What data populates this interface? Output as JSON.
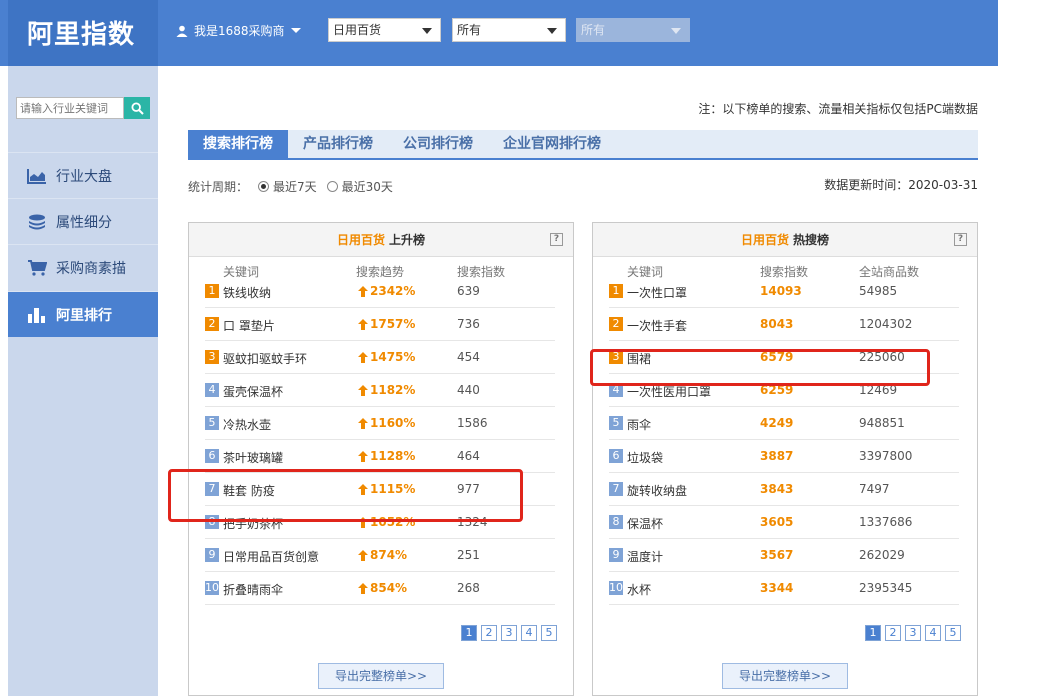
{
  "header": {
    "logo": "阿里指数",
    "user_label": "我是1688采购商",
    "select1": "日用百货",
    "select2": "所有",
    "select3": "所有"
  },
  "sidebar": {
    "search_placeholder": "请输入行业关键词",
    "items": [
      {
        "label": "行业大盘",
        "icon": "chart-icon"
      },
      {
        "label": "属性细分",
        "icon": "layers-icon"
      },
      {
        "label": "采购商素描",
        "icon": "cart-icon"
      },
      {
        "label": "阿里排行",
        "icon": "bar-rank-icon",
        "active": true
      }
    ]
  },
  "main": {
    "note": "注：以下榜单的搜索、流量相关指标仅包括PC端数据",
    "tabs": [
      "搜索排行榜",
      "产品排行榜",
      "公司排行榜",
      "企业官网排行榜"
    ],
    "period_label": "统计周期：",
    "period_options": [
      "最近7天",
      "最近30天"
    ],
    "updated": "数据更新时间：2020-03-31"
  },
  "left_panel": {
    "category": "日用百货",
    "kind": "上升榜",
    "cols": [
      "关键词",
      "搜索趋势",
      "搜索指数"
    ],
    "rows": [
      {
        "rank": "1",
        "kw": "铁线收纳",
        "trend": "2342%",
        "idx": "639"
      },
      {
        "rank": "2",
        "kw": "口 罩垫片",
        "trend": "1757%",
        "idx": "736"
      },
      {
        "rank": "3",
        "kw": "驱蚊扣驱蚊手环",
        "trend": "1475%",
        "idx": "454"
      },
      {
        "rank": "4",
        "kw": "蛋壳保温杯",
        "trend": "1182%",
        "idx": "440"
      },
      {
        "rank": "5",
        "kw": "冷热水壶",
        "trend": "1160%",
        "idx": "1586"
      },
      {
        "rank": "6",
        "kw": "茶叶玻璃罐",
        "trend": "1128%",
        "idx": "464"
      },
      {
        "rank": "7",
        "kw": "鞋套 防疫",
        "trend": "1115%",
        "idx": "977"
      },
      {
        "rank": "8",
        "kw": "把手奶茶杯",
        "trend": "1052%",
        "idx": "1324"
      },
      {
        "rank": "9",
        "kw": "日常用品百货创意",
        "trend": "874%",
        "idx": "251"
      },
      {
        "rank": "10",
        "kw": "折叠晴雨伞",
        "trend": "854%",
        "idx": "268"
      }
    ],
    "pages": [
      "1",
      "2",
      "3",
      "4",
      "5"
    ],
    "export": "导出完整榜单>>"
  },
  "right_panel": {
    "category": "日用百货",
    "kind": "热搜榜",
    "cols": [
      "关键词",
      "搜索指数",
      "全站商品数"
    ],
    "rows": [
      {
        "rank": "1",
        "kw": "一次性口罩",
        "idx": "14093",
        "count": "54985"
      },
      {
        "rank": "2",
        "kw": "一次性手套",
        "idx": "8043",
        "count": "1204302"
      },
      {
        "rank": "3",
        "kw": "围裙",
        "idx": "6579",
        "count": "225060"
      },
      {
        "rank": "4",
        "kw": "一次性医用口罩",
        "idx": "6259",
        "count": "12469"
      },
      {
        "rank": "5",
        "kw": "雨伞",
        "idx": "4249",
        "count": "948851"
      },
      {
        "rank": "6",
        "kw": "垃圾袋",
        "idx": "3887",
        "count": "3397800"
      },
      {
        "rank": "7",
        "kw": "旋转收纳盘",
        "idx": "3843",
        "count": "7497"
      },
      {
        "rank": "8",
        "kw": "保温杯",
        "idx": "3605",
        "count": "1337686"
      },
      {
        "rank": "9",
        "kw": "温度计",
        "idx": "3567",
        "count": "262029"
      },
      {
        "rank": "10",
        "kw": "水杯",
        "idx": "3344",
        "count": "2395345"
      }
    ],
    "pages": [
      "1",
      "2",
      "3",
      "4",
      "5"
    ],
    "export": "导出完整榜单>>"
  },
  "colors": {
    "primary": "#4a80d0",
    "accent": "#f08a00",
    "highlight": "#e0251b"
  }
}
